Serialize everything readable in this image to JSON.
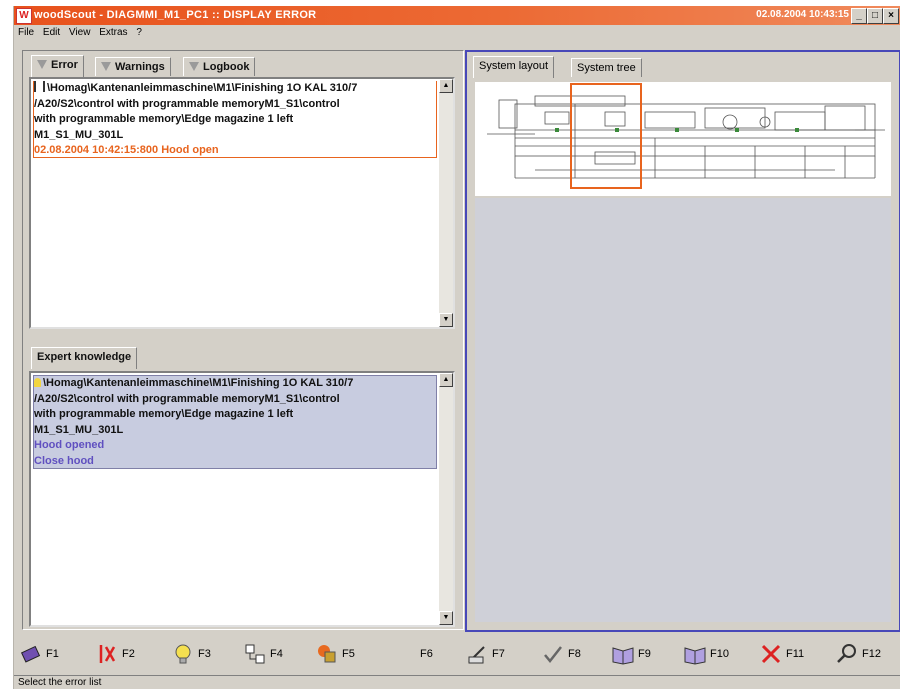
{
  "window": {
    "title": "woodScout - DIAGMMI_M1_PC1 :: DISPLAY ERROR",
    "clock": "02.08.2004 10:43:15",
    "icon": "woodscout-app-icon"
  },
  "menu": [
    "File",
    "Edit",
    "View",
    "Extras",
    "?"
  ],
  "left_tabs": [
    "Error",
    "Warnings",
    "Logbook"
  ],
  "error_entry": {
    "path_lines": [
      "\\Homag\\Kantenanleimmaschine\\M1\\Finishing 1O KAL 310/7",
      "/A20/S2\\control with programmable memoryM1_S1\\control",
      "with programmable memory\\Edge magazine 1 left",
      "M1_S1_MU_301L"
    ],
    "timestamp_line": "02.08.2004 10:42:15:800  Hood open",
    "highlight_color": "#e8641e"
  },
  "expert_tab": "Expert knowledge",
  "expert_entry": {
    "path_lines": [
      "\\Homag\\Kantenanleimmaschine\\M1\\Finishing 1O KAL 310/7",
      "/A20/S2\\control with programmable memoryM1_S1\\control",
      "with programmable memory\\Edge magazine 1 left",
      "M1_S1_MU_301L"
    ],
    "cause": "Hood opened",
    "remedy": "Close hood",
    "link_color": "#6050c0"
  },
  "right_tabs": [
    "System layout",
    "System tree"
  ],
  "function_keys": [
    {
      "label": "F1",
      "icon": "book-icon"
    },
    {
      "label": "F2",
      "icon": "error-flag-icon"
    },
    {
      "label": "F3",
      "icon": "lightbulb-icon"
    },
    {
      "label": "F4",
      "icon": "tree-view-icon"
    },
    {
      "label": "F5",
      "icon": "shapes-icon"
    },
    {
      "label": "F6",
      "icon": ""
    },
    {
      "label": "F7",
      "icon": "quill-icon"
    },
    {
      "label": "F8",
      "icon": "checkmark-icon"
    },
    {
      "label": "F9",
      "icon": "open-book-icon"
    },
    {
      "label": "F10",
      "icon": "open-book-icon"
    },
    {
      "label": "F11",
      "icon": "cancel-icon"
    },
    {
      "label": "F12",
      "icon": "magnifier-icon"
    }
  ],
  "status": "Select the error list"
}
